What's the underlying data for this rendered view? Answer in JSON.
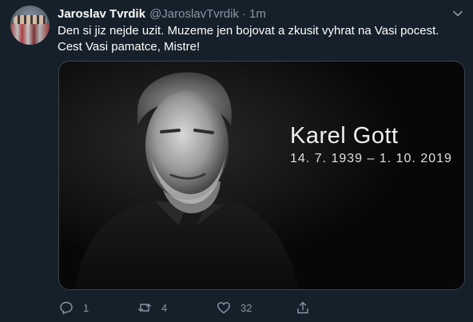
{
  "tweet": {
    "author_name": "Jaroslav Tvrdik",
    "handle": "@JaroslavTvrdik",
    "separator": "·",
    "time": "1m",
    "text": "Den si jiz nejde uzit. Muzeme jen bojovat a zkusit vyhrat na Vasi pocest. Cest Vasi pamatce, Mistre!"
  },
  "media": {
    "caption_name": "Karel Gott",
    "caption_dates": "14. 7. 1939 – 1. 10. 2019"
  },
  "actions": {
    "reply_count": "1",
    "retweet_count": "4",
    "like_count": "32"
  },
  "icons": {
    "menu": "chevron-down-icon",
    "reply": "reply-icon",
    "retweet": "retweet-icon",
    "like": "heart-icon",
    "share": "share-icon"
  },
  "colors": {
    "background": "#15202b",
    "secondary_text": "#8899a6",
    "border": "#38444d"
  }
}
